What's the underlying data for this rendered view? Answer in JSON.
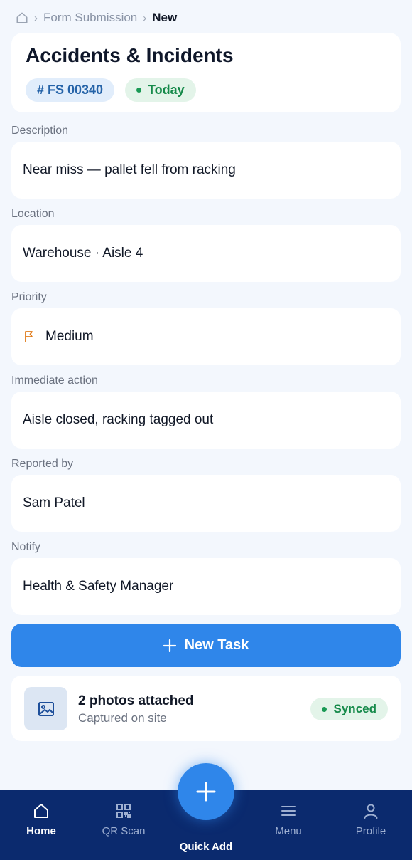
{
  "breadcrumb": {
    "items": [
      "Form Submission"
    ],
    "current": "New"
  },
  "header": {
    "title": "Accidents & Incidents",
    "id_chip": "# FS 00340",
    "date_chip": "Today"
  },
  "fields": [
    {
      "label": "Description",
      "value": "Near miss — pallet fell from racking"
    },
    {
      "label": "Location",
      "value": "Warehouse · Aisle 4"
    },
    {
      "label": "Priority",
      "value": "Medium",
      "icon": "flag-icon"
    },
    {
      "label": "Immediate action",
      "value": "Aisle closed, racking tagged out"
    },
    {
      "label": "Reported by",
      "value": "Sam Patel"
    },
    {
      "label": "Notify",
      "value": "Health & Safety Manager"
    }
  ],
  "actions": {
    "new_task_label": "New Task"
  },
  "attachments": {
    "title": "2 photos attached",
    "subtitle": "Captured on site",
    "status": "Synced"
  },
  "bottom_nav": {
    "items": [
      {
        "label": "Home",
        "icon": "home-icon",
        "active": true
      },
      {
        "label": "QR Scan",
        "icon": "qr-icon",
        "active": false
      },
      {
        "label": "Menu",
        "icon": "menu-icon",
        "active": false
      },
      {
        "label": "Profile",
        "icon": "profile-icon",
        "active": false
      }
    ],
    "fab_label": "Quick Add"
  },
  "colors": {
    "accent": "#2f86ea",
    "nav_background": "#0b2a6e",
    "success": "#168a4a",
    "priority_flag": "#e07b1a",
    "page_background": "#f3f7fd"
  }
}
